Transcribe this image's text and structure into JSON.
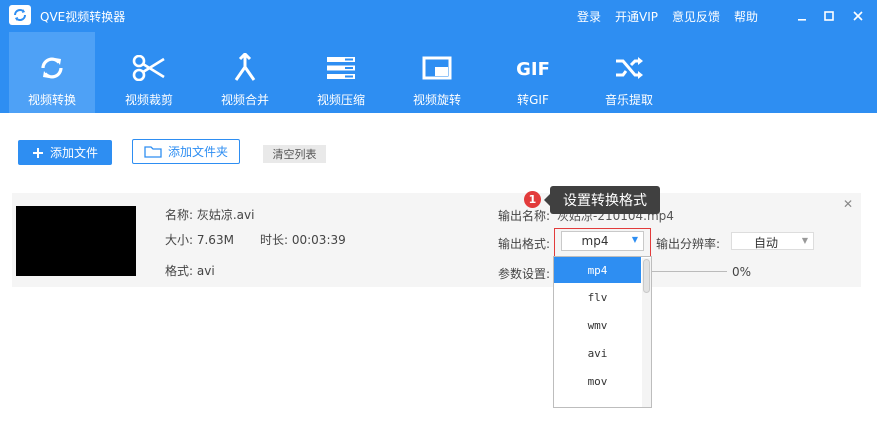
{
  "app": {
    "title": "QVE视频转换器",
    "header_links": [
      "登录",
      "开通VIP",
      "意见反馈",
      "帮助"
    ]
  },
  "toolbar": {
    "items": [
      {
        "label": "视频转换",
        "icon": "convert-icon",
        "active": true
      },
      {
        "label": "视频裁剪",
        "icon": "scissors-icon",
        "active": false
      },
      {
        "label": "视频合并",
        "icon": "merge-icon",
        "active": false
      },
      {
        "label": "视频压缩",
        "icon": "compress-icon",
        "active": false
      },
      {
        "label": "视频旋转",
        "icon": "rotate-icon",
        "active": false
      },
      {
        "label": "转GIF",
        "icon": "gif-icon",
        "active": false
      },
      {
        "label": "音乐提取",
        "icon": "shuffle-icon",
        "active": false
      }
    ]
  },
  "actions": {
    "add_file": "添加文件",
    "add_folder": "添加文件夹",
    "clear_list": "清空列表"
  },
  "file": {
    "name": "名称: 灰姑凉.avi",
    "size": "大小: 7.63M",
    "duration": "时长: 00:03:39",
    "format": "格式: avi",
    "output_name_label": "输出名称:",
    "output_name_value": "灰姑凉-210104.mp4",
    "output_format_label": "输出格式:",
    "output_format_value": "mp4",
    "resolution_label": "输出分辨率:",
    "resolution_value": "自动",
    "params_label": "参数设置:",
    "progress_text": "0%"
  },
  "tooltip": {
    "step": "1",
    "text": "设置转换格式"
  },
  "format_options": [
    "mp4",
    "flv",
    "wmv",
    "avi",
    "mov"
  ],
  "colors": {
    "brand": "#2e8ef2",
    "active_tab": "#4ea1f6",
    "highlight": "#e23b3b"
  }
}
